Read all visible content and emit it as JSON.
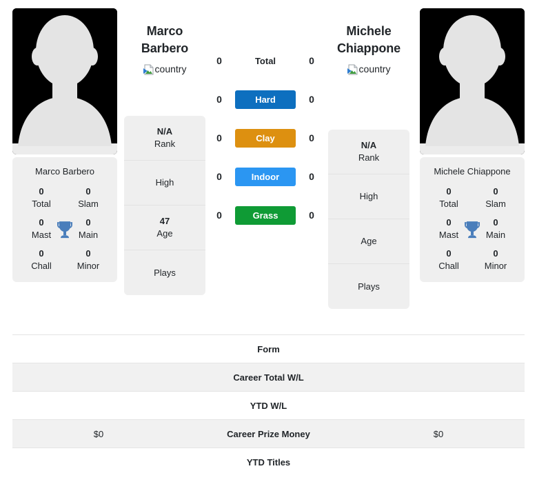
{
  "players": {
    "left": {
      "name_line1": "Marco",
      "name_line2": "Barbero",
      "full_name": "Marco Barbero",
      "country_alt": "country",
      "rank_value": "N/A",
      "rank_label": "Rank",
      "high_label": "High",
      "high_value": "",
      "age_value": "47",
      "age_label": "Age",
      "plays_label": "Plays",
      "plays_value": "",
      "titles": {
        "total": {
          "value": "0",
          "label": "Total"
        },
        "slam": {
          "value": "0",
          "label": "Slam"
        },
        "mast": {
          "value": "0",
          "label": "Mast"
        },
        "main": {
          "value": "0",
          "label": "Main"
        },
        "chall": {
          "value": "0",
          "label": "Chall"
        },
        "minor": {
          "value": "0",
          "label": "Minor"
        }
      }
    },
    "right": {
      "name_line1": "Michele",
      "name_line2": "Chiappone",
      "full_name": "Michele Chiappone",
      "country_alt": "country",
      "rank_value": "N/A",
      "rank_label": "Rank",
      "high_label": "High",
      "high_value": "",
      "age_value": "",
      "age_label": "Age",
      "plays_label": "Plays",
      "plays_value": "",
      "titles": {
        "total": {
          "value": "0",
          "label": "Total"
        },
        "slam": {
          "value": "0",
          "label": "Slam"
        },
        "mast": {
          "value": "0",
          "label": "Mast"
        },
        "main": {
          "value": "0",
          "label": "Main"
        },
        "chall": {
          "value": "0",
          "label": "Chall"
        },
        "minor": {
          "value": "0",
          "label": "Minor"
        }
      }
    }
  },
  "surfaces": [
    {
      "label": "Total",
      "left": "0",
      "right": "0",
      "color": "transparent",
      "text_color": "#212529",
      "tinted": false
    },
    {
      "label": "Hard",
      "left": "0",
      "right": "0",
      "color": "#0d6fbf",
      "text_color": "#ffffff",
      "tinted": true
    },
    {
      "label": "Clay",
      "left": "0",
      "right": "0",
      "color": "#dd9010",
      "text_color": "#ffffff",
      "tinted": true
    },
    {
      "label": "Indoor",
      "left": "0",
      "right": "0",
      "color": "#2b96f2",
      "text_color": "#ffffff",
      "tinted": true
    },
    {
      "label": "Grass",
      "left": "0",
      "right": "0",
      "color": "#0f9b35",
      "text_color": "#ffffff",
      "tinted": true
    }
  ],
  "comparison_rows": [
    {
      "label": "Form",
      "left": "",
      "right": "",
      "shaded": false
    },
    {
      "label": "Career Total W/L",
      "left": "",
      "right": "",
      "shaded": true
    },
    {
      "label": "YTD W/L",
      "left": "",
      "right": "",
      "shaded": false
    },
    {
      "label": "Career Prize Money",
      "left": "$0",
      "right": "$0",
      "shaded": true
    },
    {
      "label": "YTD Titles",
      "left": "",
      "right": "",
      "shaded": false
    }
  ],
  "icons": {
    "trophy": "trophy-icon",
    "avatar": "player-avatar-silhouette",
    "broken_image": "broken-image-icon"
  },
  "colors": {
    "card_background": "#efefef",
    "photo_background": "#000000",
    "silhouette": "#e2e2e2",
    "trophy": "#4a7ebb",
    "row_shaded": "#f1f1f1",
    "border": "#e4e4e4"
  }
}
